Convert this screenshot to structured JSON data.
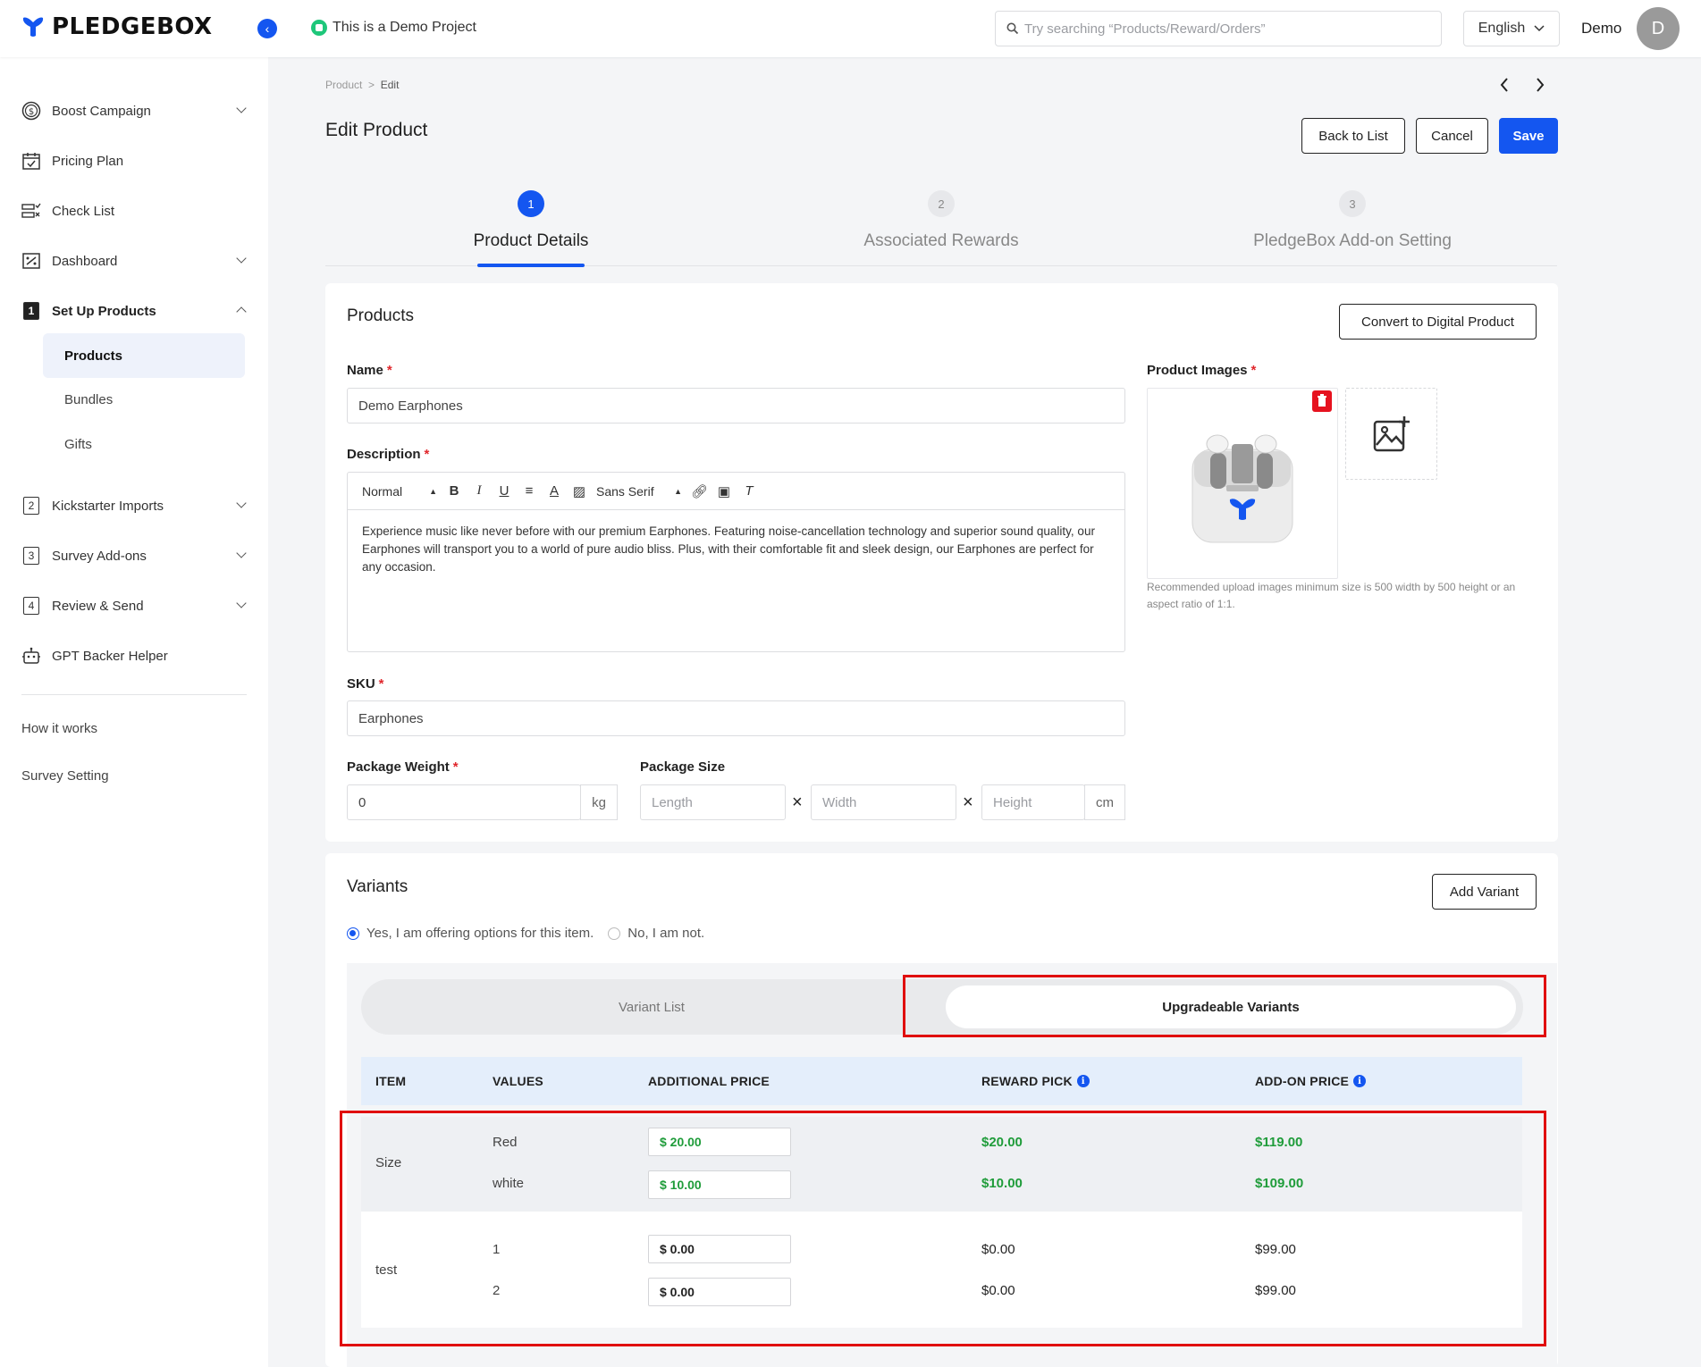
{
  "topbar": {
    "logo_text": "PLEDGEBOX",
    "demo_label": "This is a Demo Project",
    "search_placeholder": "Try searching “Products/Reward/Orders”",
    "language": "English",
    "user_name": "Demo",
    "avatar_initial": "D"
  },
  "sidebar": {
    "items": [
      {
        "label": "Boost Campaign"
      },
      {
        "label": "Pricing Plan"
      },
      {
        "label": "Check List"
      },
      {
        "label": "Dashboard"
      },
      {
        "label": "Set Up Products",
        "number": "1"
      },
      {
        "label": "Kickstarter Imports",
        "number": "2"
      },
      {
        "label": "Survey Add-ons",
        "number": "3"
      },
      {
        "label": "Review & Send",
        "number": "4"
      },
      {
        "label": "GPT Backer Helper"
      }
    ],
    "sub_items": [
      "Products",
      "Bundles",
      "Gifts"
    ],
    "footer_links": [
      "How it works",
      "Survey Setting"
    ]
  },
  "breadcrumb": {
    "root": "Product",
    "sep": ">",
    "current": "Edit"
  },
  "page": {
    "title": "Edit Product",
    "back_to_list": "Back to List",
    "cancel": "Cancel",
    "save": "Save"
  },
  "steps": [
    {
      "number": "1",
      "label": "Product Details"
    },
    {
      "number": "2",
      "label": "Associated Rewards"
    },
    {
      "number": "3",
      "label": "PledgeBox Add-on Setting"
    }
  ],
  "products": {
    "title": "Products",
    "convert_button": "Convert to Digital Product",
    "name_label": "Name",
    "name_value": "Demo Earphones",
    "description_label": "Description",
    "editor_format": "Normal",
    "editor_font": "Sans Serif",
    "description_text": "Experience music like never before with our premium Earphones. Featuring noise-cancellation technology and superior sound quality, our Earphones will transport you to a world of pure audio bliss. Plus, with their comfortable fit and sleek design, our Earphones are perfect for any occasion.",
    "sku_label": "SKU",
    "sku_value": "Earphones",
    "weight_label": "Package Weight",
    "weight_value": "0",
    "weight_unit": "kg",
    "size_label": "Package Size",
    "length_placeholder": "Length",
    "width_placeholder": "Width",
    "height_placeholder": "Height",
    "size_unit": "cm",
    "times": "×",
    "images_label": "Product Images",
    "images_hint": "Recommended upload images minimum size is 500 width by 500 height or an aspect ratio of 1:1.",
    "required_mark": "*"
  },
  "variants": {
    "title": "Variants",
    "add_button": "Add Variant",
    "radio_yes": "Yes, I am offering options for this item.",
    "radio_no": "No, I am not.",
    "tab_list": "Variant List",
    "tab_upgradeable": "Upgradeable Variants",
    "columns": [
      "ITEM",
      "VALUES",
      "ADDITIONAL PRICE",
      "REWARD PICK",
      "ADD-ON PRICE"
    ],
    "groups": [
      {
        "item": "Size",
        "rows": [
          {
            "value": "Red",
            "additional": "$ 20.00",
            "reward": "$20.00",
            "addon": "$119.00"
          },
          {
            "value": "white",
            "additional": "$ 10.00",
            "reward": "$10.00",
            "addon": "$109.00"
          }
        ]
      },
      {
        "item": "test",
        "rows": [
          {
            "value": "1",
            "additional": "$ 0.00",
            "reward": "$0.00",
            "addon": "$99.00"
          },
          {
            "value": "2",
            "additional": "$ 0.00",
            "reward": "$0.00",
            "addon": "$99.00"
          }
        ]
      }
    ]
  },
  "colors": {
    "accent": "#1456f0",
    "highlight_red": "#e00e0e",
    "price_green": "#1f9c3a",
    "required": "#e0262b"
  }
}
